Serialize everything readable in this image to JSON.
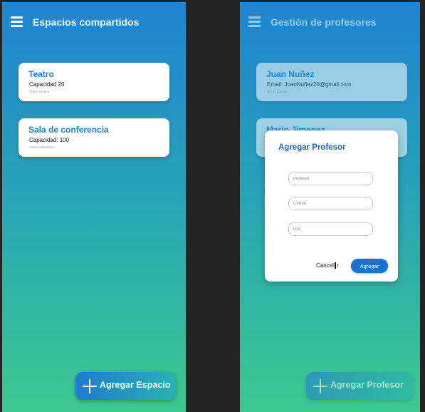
{
  "left_screen": {
    "title": "Espacios compartidos",
    "spaces": [
      {
        "name": "Teatro",
        "capacity": "Capacidad 20",
        "description": "Teatro musica"
      },
      {
        "name": "Sala de conferencia",
        "capacity": "Capacidad: 100",
        "description": "Sala conferencias"
      }
    ],
    "fab_label": "Agregar Espacio"
  },
  "right_screen": {
    "title": "Gestión de profesores",
    "professors": [
      {
        "name": "Juan Nuñez",
        "email": "Email: JuanNuñez20@gmail.com",
        "detail": "Dni 40124035"
      },
      {
        "name": "Mario Jimenez",
        "email": "",
        "detail": ""
      }
    ],
    "fab_label": "Agregar Profesor",
    "dialog": {
      "title": "Agregar Profesor",
      "placeholders": {
        "professor": "Profesor",
        "email": "Correo",
        "dni": "DNI"
      },
      "cancel_label": "Cancelar",
      "add_label": "Agregar"
    }
  },
  "colors": {
    "gradient_top": "#1f84d2",
    "gradient_bottom": "#3ec88f",
    "accent_blue": "#1f7fcf",
    "button_blue": "#1f6fce",
    "backdrop": "#232323"
  }
}
